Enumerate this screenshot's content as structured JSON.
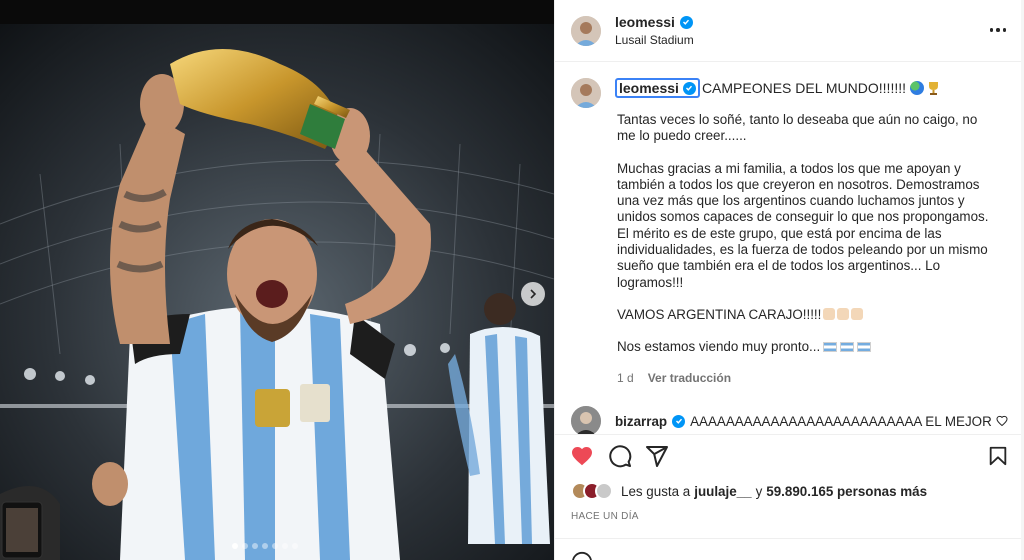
{
  "header": {
    "username": "leomessi",
    "location": "Lusail Stadium"
  },
  "caption": {
    "username": "leomessi",
    "headline": "CAMPEONES DEL MUNDO!!!!!!!",
    "paragraphs": [
      "Tantas veces lo soñé, tanto lo deseaba que aún no caigo, no me lo puedo creer......",
      "Muchas gracias a mi familia, a todos los que me apoyan y también a todos los que creyeron en nosotros. Demostramos una vez más que los argentinos cuando luchamos juntos y unidos somos capaces de conseguir lo que nos propongamos. El mérito es de este grupo, que está por encima de las individualidades, es la fuerza de todos peleando por un mismo sueño que también era el de todos los argentinos... Lo logramos!!!",
      "VAMOS ARGENTINA CARAJO!!!!!",
      "Nos estamos viendo muy pronto..."
    ],
    "time": "1 d",
    "translate": "Ver traducción"
  },
  "comment": {
    "username": "bizarrap",
    "text": "AAAAAAAAAAAAAAAAAAAAAAAAAA EL MEJOR"
  },
  "likes": {
    "prefix": "Les gusta a",
    "user": "juulaje__",
    "joiner": "y",
    "count": "59.890.165 personas más"
  },
  "posted": "HACE UN DÍA",
  "colors": {
    "heart": "#ed4956",
    "verified": "#0095f6",
    "muted": "#737373"
  },
  "icons": [
    "like-heart-icon",
    "comment-icon",
    "share-icon",
    "save-icon",
    "more-icon",
    "verified-icon",
    "next-arrow-icon"
  ]
}
